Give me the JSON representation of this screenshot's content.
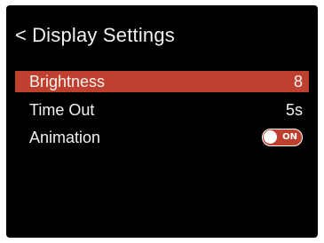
{
  "header": {
    "back_glyph": "<",
    "title": "Display Settings"
  },
  "settings": [
    {
      "label": "Brightness",
      "value": "8",
      "selected": true
    },
    {
      "label": "Time Out",
      "value": "5s",
      "selected": false
    },
    {
      "label": "Animation",
      "toggle_text": "ON",
      "toggle_on": true,
      "selected": false
    }
  ],
  "colors": {
    "background": "#000000",
    "selection": "#c0402f",
    "text": "#f2f2f2"
  }
}
